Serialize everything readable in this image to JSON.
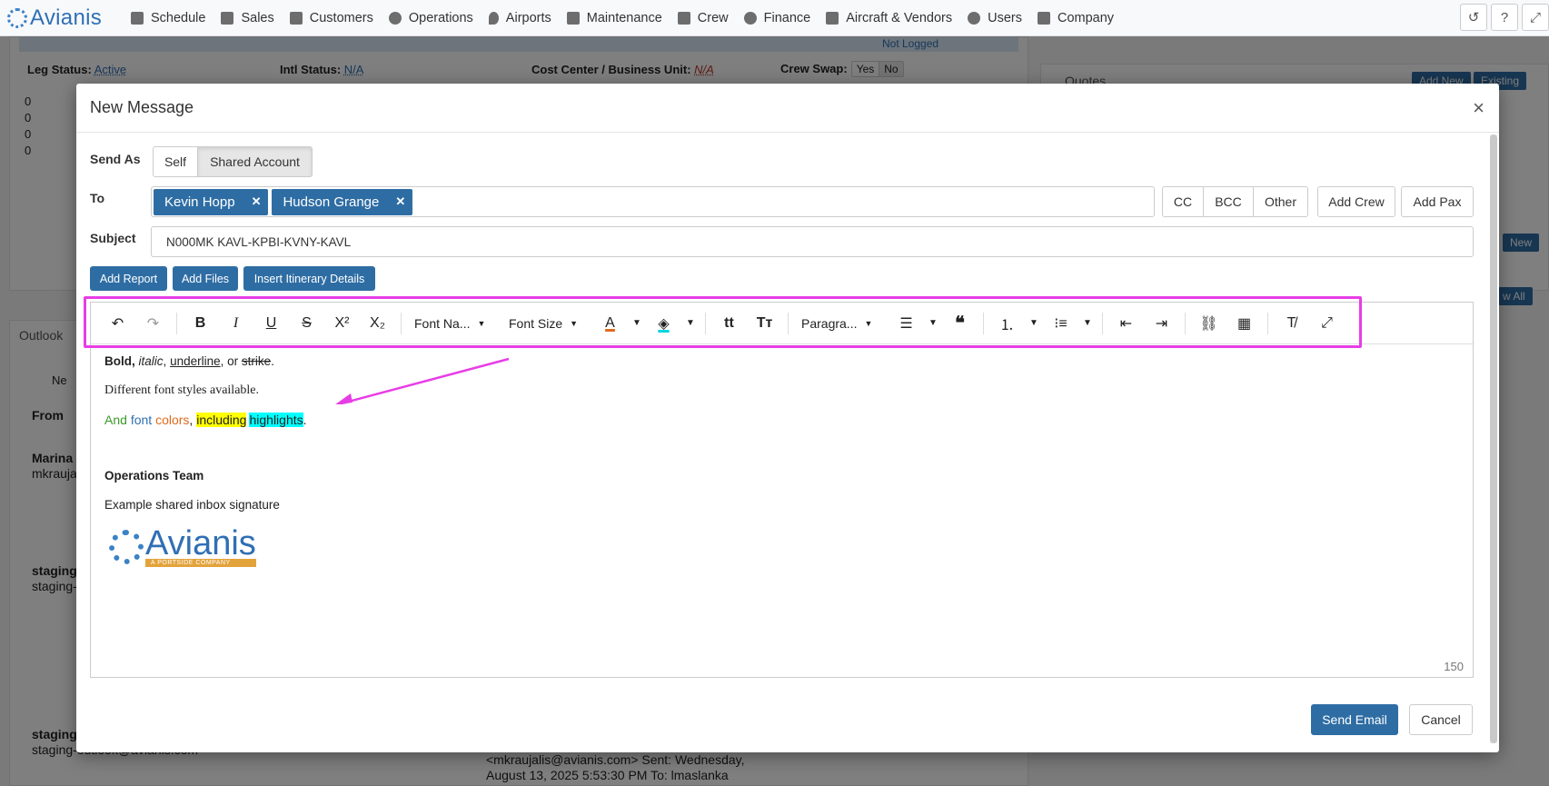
{
  "nav": {
    "brand": "Avianis",
    "items": [
      "Schedule",
      "Sales",
      "Customers",
      "Operations",
      "Airports",
      "Maintenance",
      "Crew",
      "Finance",
      "Aircraft & Vendors",
      "Users",
      "Company"
    ],
    "right_icons": [
      "history-icon",
      "help-icon",
      "fullscreen-icon"
    ]
  },
  "background": {
    "not_logged": "Not Logged",
    "leg_status_label": "Leg Status:",
    "leg_status_value": "Active",
    "intl_status_label": "Intl Status:",
    "intl_status_value": "N/A",
    "cost_center_label": "Cost Center / Business Unit:",
    "cost_center_value": "N/A",
    "crew_swap_label": "Crew Swap:",
    "crew_swap_yes": "Yes",
    "crew_swap_no": "No",
    "counts": [
      "0",
      "0",
      "0",
      "0"
    ],
    "quotes_label": "Quotes",
    "add_new": "Add New",
    "existing": "Existing",
    "new_label": "New",
    "view_all": "w All",
    "outlook_label": "Outlook",
    "from_header": "From",
    "new_btn": "Ne",
    "sender1": "Marina",
    "sender1_email": "mkrauja",
    "sender2": "staging",
    "sender2_email": "staging-",
    "sender3": "staging",
    "sender3_email": "staging-outlook@avianis.com",
    "preview_text_1": "<mkraujalis@avianis.com> Sent: Wednesday,",
    "preview_text_2": "August 13, 2025 5:53:30 PM To: lmaslanka"
  },
  "modal": {
    "title": "New Message",
    "close": "×",
    "send_as_label": "Send As",
    "send_as_options": [
      "Self",
      "Shared Account"
    ],
    "send_as_selected": "Shared Account",
    "to_label": "To",
    "recipients": [
      "Kevin Hopp",
      "Hudson Grange"
    ],
    "recipient_remove": "✕",
    "cc": "CC",
    "bcc": "BCC",
    "other": "Other",
    "add_crew": "Add Crew",
    "add_pax": "Add Pax",
    "subject_label": "Subject",
    "subject_value": "N000MK KAVL-KPBI-KVNY-KAVL",
    "add_report": "Add Report",
    "add_files": "Add Files",
    "insert_itinerary": "Insert Itinerary Details",
    "toolbar": {
      "font_name": "Font Na...",
      "font_size": "Font Size",
      "paragraph": "Paragra..."
    },
    "body": {
      "line1_bold": "Bold,",
      "line1_italic": "italic",
      "line1_sep1": ",",
      "line1_underline": "underline",
      "line1_sep2": ", or",
      "line1_strike": "strike",
      "line1_end": ".",
      "line2": "Different font styles available.",
      "line3_and": "And",
      "line3_font": "font",
      "line3_colors": "colors",
      "line3_comma": ",",
      "line3_including": "including",
      "line3_highlights": "highlights",
      "line3_end": ".",
      "sig_team": "Operations Team",
      "sig_text": "Example shared inbox signature",
      "sig_logo_word": "Avianis",
      "sig_logo_tag": "A PORTSIDE COMPANY"
    },
    "char_count": "150",
    "send_email": "Send Email",
    "cancel": "Cancel"
  },
  "colors": {
    "primary": "#2e6da4",
    "annotation": "#e83de6",
    "green_text": "#3a9a2a",
    "blue_text": "#2f6fb4",
    "orange_text": "#e06a1b",
    "yellow_highlight": "#ffff00",
    "cyan_highlight": "#00ffff"
  }
}
